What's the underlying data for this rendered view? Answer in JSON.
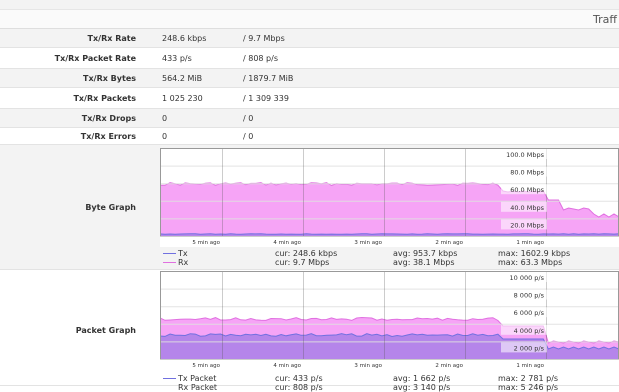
{
  "section_title": "Traff",
  "stats": [
    {
      "label": "Tx/Rx Rate",
      "tx": "248.6 kbps",
      "rx": "/  9.7 Mbps"
    },
    {
      "label": "Tx/Rx Packet Rate",
      "tx": "433 p/s",
      "rx": "/  808 p/s"
    },
    {
      "label": "Tx/Rx Bytes",
      "tx": "564.2 MiB",
      "rx": "/  1879.7 MiB"
    },
    {
      "label": "Tx/Rx Packets",
      "tx": "1 025 230",
      "rx": "/  1 309 339"
    },
    {
      "label": "Tx/Rx Drops",
      "tx": "0",
      "rx": "/  0"
    },
    {
      "label": "Tx/Rx Errors",
      "tx": "0",
      "rx": "/  0"
    }
  ],
  "byte_graph": {
    "label": "Byte Graph",
    "y_ticks": [
      "100.0 Mbps",
      "80.0 Mbps",
      "60.0 Mbps",
      "40.0 Mbps",
      "20.0 Mbps"
    ],
    "x_ticks": [
      "5 min ago",
      "4 min ago",
      "3 min ago",
      "2 min ago",
      "1 min ago"
    ],
    "legend": [
      {
        "name": "Tx",
        "cur": "cur: 248.6 kbps",
        "avg": "avg: 953.7 kbps",
        "max": "max: 1602.9 kbps",
        "color": "#7070e0"
      },
      {
        "name": "Rx",
        "cur": "cur: 9.7 Mbps",
        "avg": "avg: 38.1 Mbps",
        "max": "max: 63.3 Mbps",
        "color": "#e070e0"
      }
    ]
  },
  "packet_graph": {
    "label": "Packet Graph",
    "y_ticks": [
      "10 000 p/s",
      "8 000 p/s",
      "6 000 p/s",
      "4 000 p/s",
      "2 000 p/s"
    ],
    "x_ticks": [
      "5 min ago",
      "4 min ago",
      "3 min ago",
      "2 min ago",
      "1 min ago"
    ],
    "legend": [
      {
        "name": "Tx Packet",
        "cur": "cur: 433 p/s",
        "avg": "avg: 1 662 p/s",
        "max": "max: 2 781 p/s",
        "color": "#7070e0"
      },
      {
        "name": "Rx Packet",
        "cur": "cur: 808 p/s",
        "avg": "avg: 3 140 p/s",
        "max": "max: 5 246 p/s",
        "color": "#e070e0"
      }
    ]
  },
  "colors": {
    "rx_fill": "#f6a4f6",
    "rx_line": "#e070e0",
    "tx_fill": "#b585ea",
    "tx_line": "#7070e0",
    "grid": "#e0e0e0"
  }
}
